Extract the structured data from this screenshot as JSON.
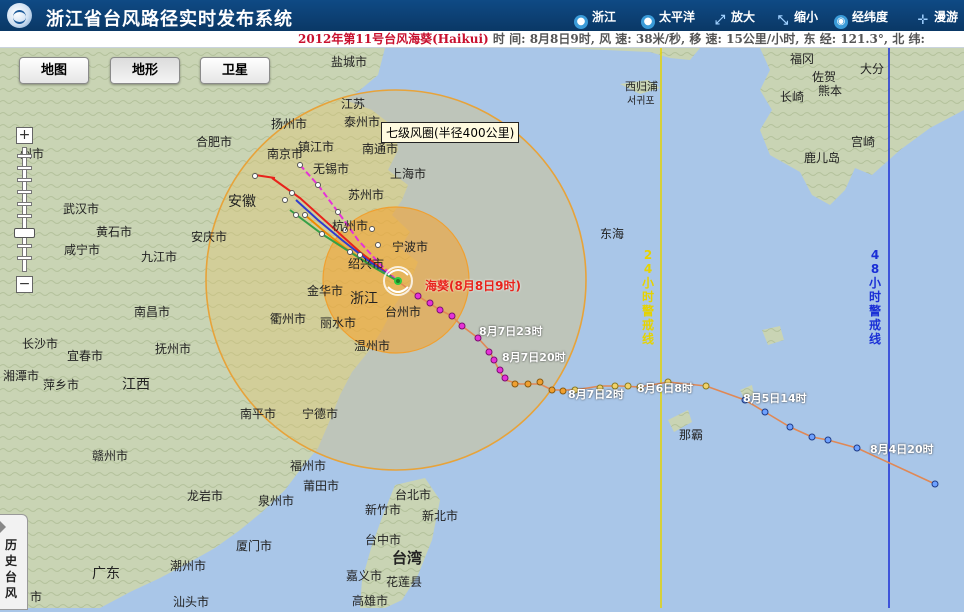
{
  "header": {
    "title": "浙江省台风路径实时发布系统",
    "buttons": [
      {
        "label": "浙江",
        "icon": "globe-icon"
      },
      {
        "label": "太平洋",
        "icon": "globe-icon"
      },
      {
        "label": "放大",
        "icon": "zoom-in-icon"
      },
      {
        "label": "缩小",
        "icon": "zoom-out-icon"
      },
      {
        "label": "经纬度",
        "icon": "latlng-icon"
      },
      {
        "label": "漫游",
        "icon": "pan-icon"
      }
    ]
  },
  "ticker": {
    "typhoon": "2012年第11号台风海葵(Haikui)",
    "info": " 时 间: 8月8日9时,  风 速: 38米/秒,  移 速: 15公里/小时,  东 经: 121.3°,  北 纬:"
  },
  "map_types": [
    "地图",
    "地形",
    "卫星"
  ],
  "active_map_type": "地形",
  "zoom": {
    "plus": "+",
    "minus": "−"
  },
  "history_tab": "历史台风",
  "circle_label": "七级风圈(半径400公里)",
  "typhoon_label": "海葵(8月8日9时)",
  "track_labels": [
    "8月7日23时",
    "8月7日20时",
    "8月7日2时",
    "8月6日8时",
    "8月5日14时",
    "8月4日20时"
  ],
  "warning_lines": [
    {
      "label": "24小时警戒线",
      "color": "#e6d300"
    },
    {
      "label": "48小时警戒线",
      "color": "#1a2fd6"
    }
  ],
  "place_labels": [
    "盐城市",
    "江苏",
    "扬州市",
    "泰州市",
    "南京市",
    "镇江市",
    "合肥市",
    "无锡市",
    "南通市",
    "上海市",
    "苏州市",
    "安徽",
    "杭州市",
    "宁波市",
    "绍兴市",
    "东海",
    "浙江",
    "金华市",
    "衢州市",
    "丽水市",
    "台州市",
    "温州市",
    "武汉市",
    "黄石市",
    "咸宁市",
    "九江市",
    "安庆市",
    "南昌市",
    "抚州市",
    "长沙市",
    "宜春市",
    "湘潭市",
    "萍乡市",
    "江西",
    "南平市",
    "宁德市",
    "福州市",
    "莆田市",
    "泉州市",
    "龙岩市",
    "厦门市",
    "赣州市",
    "潮州市",
    "汕头市",
    "广东",
    "台北市",
    "新竹市",
    "新北市",
    "台中市",
    "台湾",
    "嘉义市",
    "花莲县",
    "高雄市",
    "那霸",
    "西归浦",
    "서귀포",
    "佐贺",
    "长崎",
    "熊本",
    "大分",
    "宫崎",
    "鹿儿岛",
    "福冈",
    "州市",
    "市"
  ],
  "colors": {
    "accent": "#0a3866",
    "circle7": "#e7a33a",
    "circle10": "#f0a030",
    "forecast_china": "#e8221b",
    "forecast_japan": "#2f3ccf",
    "forecast_korea": "#f08a00",
    "forecast_hk": "#e632d8",
    "forecast_taiwan": "#35a047",
    "track_past": "#f1d36a"
  }
}
